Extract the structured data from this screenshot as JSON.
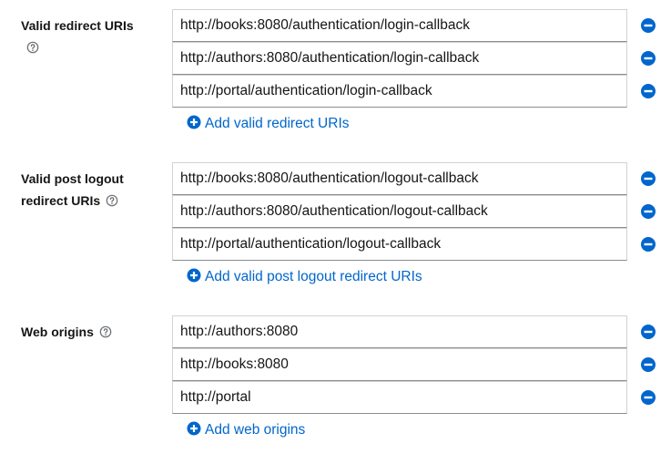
{
  "colors": {
    "accent": "#0066cc",
    "text": "#151515",
    "border": "#d2d2d2",
    "help": "#6a6e73"
  },
  "redirect": {
    "label": "Valid redirect URIs",
    "values": [
      "http://books:8080/authentication/login-callback",
      "http://authors:8080/authentication/login-callback",
      "http://portal/authentication/login-callback"
    ],
    "add_label": "Add valid redirect URIs"
  },
  "logout": {
    "label_line1": "Valid post logout",
    "label_line2": "redirect URIs",
    "values": [
      "http://books:8080/authentication/logout-callback",
      "http://authors:8080/authentication/logout-callback",
      "http://portal/authentication/logout-callback"
    ],
    "add_label": "Add valid post logout redirect URIs"
  },
  "origins": {
    "label": "Web origins",
    "values": [
      "http://authors:8080",
      "http://books:8080",
      "http://portal"
    ],
    "add_label": "Add web origins"
  },
  "icons": {
    "help": "help-circle-icon",
    "remove": "minus-circle-icon",
    "add": "plus-circle-icon"
  }
}
